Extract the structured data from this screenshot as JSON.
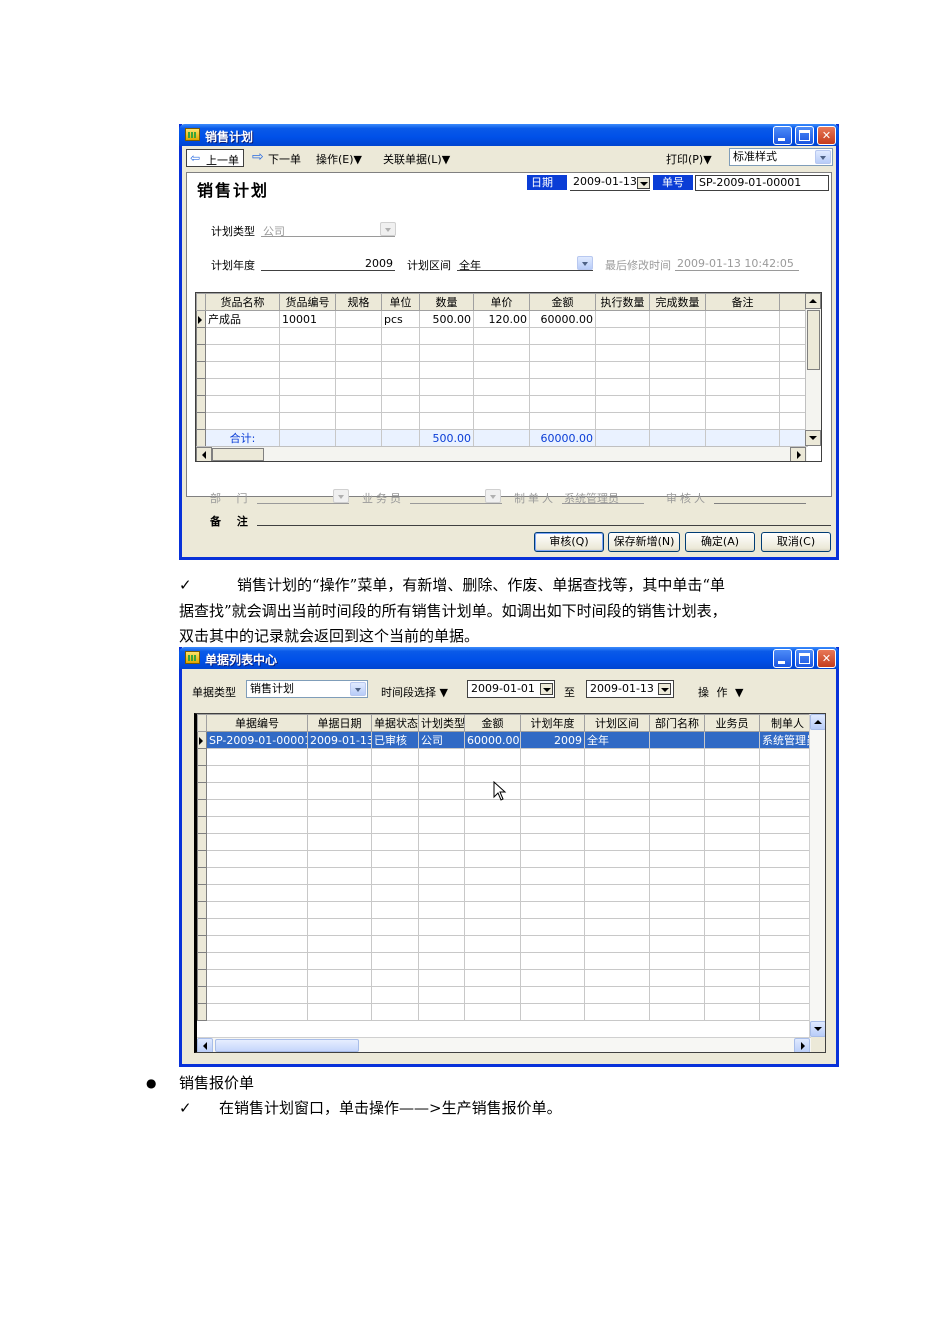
{
  "window1": {
    "title": "销售计划",
    "toolbar": {
      "prev": "上一单",
      "next": "下一单",
      "operate": "操作(E)▼",
      "related": "关联单据(L)▼",
      "print": "打印(P)▼",
      "style": "标准样式"
    },
    "heading": "销售计划",
    "date_label": "日期",
    "date_value": "2009-01-13",
    "docno_label": "单号",
    "docno_value": "SP-2009-01-00001",
    "plan_type_label": "计划类型",
    "plan_type_value": "公司",
    "plan_year_label": "计划年度",
    "plan_year_value": "2009",
    "plan_period_label": "计划区间",
    "plan_period_value": "全年",
    "last_modified_label": "最后修改时间",
    "last_modified_value": "2009-01-13 10:42:05",
    "grid": {
      "columns": [
        "货品名称",
        "货品编号",
        "规格",
        "单位",
        "数量",
        "单价",
        "金额",
        "执行数量",
        "完成数量",
        "备注"
      ],
      "rows": [
        [
          "产成品",
          "10001",
          "",
          "pcs",
          "500.00",
          "120.00",
          "60000.00",
          "",
          "",
          ""
        ]
      ],
      "total_label": "合计:",
      "total_qty": "500.00",
      "total_amount": "60000.00"
    },
    "dept_label": "部 门",
    "salesman_label": "业务员",
    "maker_label": "制单人",
    "maker_value": "系统管理员",
    "auditor_label": "审核人",
    "remark_label": "备 注",
    "buttons": {
      "audit": "审核(Q)",
      "save_new": "保存新增(N)",
      "confirm": "确定(A)",
      "cancel": "取消(C)"
    }
  },
  "paragraph1": {
    "check": "✓",
    "line1": "销售计划的“操作”菜单，有新增、删除、作废、单据查找等，其中单击“单",
    "line2": "据查找”就会调出当前时间段的所有销售计划单。如调出如下时间段的销售计划表，",
    "line3": "双击其中的记录就会返回到这个当前的单据。"
  },
  "window2": {
    "title": "单据列表中心",
    "doc_type_label": "单据类型",
    "doc_type_value": "销售计划",
    "period_label": "时间段选择 ▼",
    "from_date": "2009-01-01",
    "to_label": "至",
    "to_date": "2009-01-13",
    "operate_label": "操 作 ▼",
    "grid": {
      "columns": [
        "单据编号",
        "单据日期",
        "单据状态",
        "计划类型",
        "金额",
        "计划年度",
        "计划区间",
        "部门名称",
        "业务员",
        "制单人"
      ],
      "rows": [
        [
          "SP-2009-01-00001",
          "2009-01-13",
          "已审核",
          "公司",
          "60000.00",
          "2009",
          "全年",
          "",
          "",
          "系统管理员"
        ]
      ]
    }
  },
  "bullet": {
    "dot": "●",
    "title": "销售报价单",
    "check": "✓",
    "text": "在销售计划窗口，单击操作——>生产销售报价单。"
  }
}
